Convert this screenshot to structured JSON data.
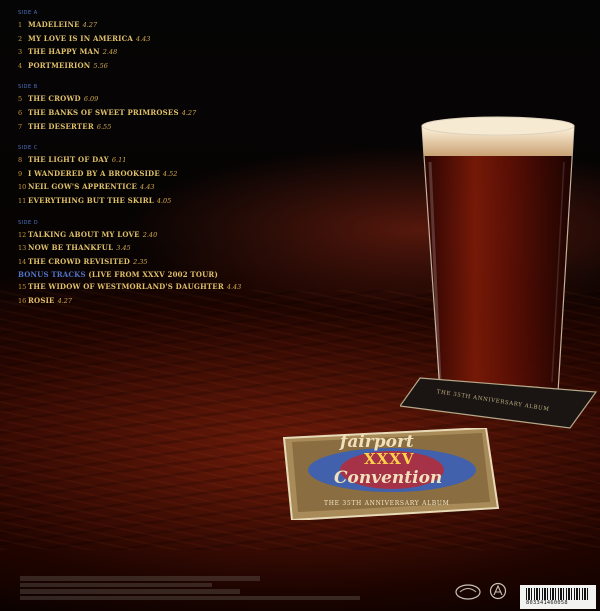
{
  "sides": [
    {
      "label": "SIDE A",
      "tracks": [
        {
          "n": "1",
          "title": "MADELEINE",
          "dur": "4.27"
        },
        {
          "n": "2",
          "title": "MY LOVE IS IN AMERICA",
          "dur": "4.43"
        },
        {
          "n": "3",
          "title": "THE HAPPY MAN",
          "dur": "2.48"
        },
        {
          "n": "4",
          "title": "PORTMEIRION",
          "dur": "5.56"
        }
      ]
    },
    {
      "label": "SIDE B",
      "tracks": [
        {
          "n": "5",
          "title": "THE CROWD",
          "dur": "6.09"
        },
        {
          "n": "6",
          "title": "THE BANKS OF SWEET PRIMROSES",
          "dur": "4.27"
        },
        {
          "n": "7",
          "title": "THE DESERTER",
          "dur": "6.55"
        }
      ]
    },
    {
      "label": "SIDE C",
      "tracks": [
        {
          "n": "8",
          "title": "THE LIGHT OF DAY",
          "dur": "6.11"
        },
        {
          "n": "9",
          "title": "I WANDERED BY A BROOKSIDE",
          "dur": "4.52"
        },
        {
          "n": "10",
          "title": "NEIL GOW'S APPRENTICE",
          "dur": "4.43"
        },
        {
          "n": "11",
          "title": "EVERYTHING BUT THE SKIRL",
          "dur": "4.05"
        }
      ]
    },
    {
      "label": "SIDE D",
      "tracks": [
        {
          "n": "12",
          "title": "TALKING ABOUT MY LOVE",
          "dur": "2.40"
        },
        {
          "n": "13",
          "title": "NOW BE THANKFUL",
          "dur": "3.45"
        },
        {
          "n": "14",
          "title": "THE CROWD REVISITED",
          "dur": "2.35"
        }
      ]
    }
  ],
  "bonus_label": "BONUS TRACKS",
  "bonus_note": "(LIVE FROM XXXV 2002 TOUR)",
  "bonus_tracks": [
    {
      "n": "15",
      "title": "THE WIDOW OF WESTMORLAND'S DAUGHTER",
      "dur": "4.43"
    },
    {
      "n": "16",
      "title": "ROSIE",
      "dur": "4.27"
    }
  ],
  "coaster": {
    "line1": "fairport",
    "line2": "XXXV",
    "line3": "Convention",
    "tagline": "THE 35TH ANNIVERSARY ALBUM",
    "small_tagline": "THE 35TH ANNIVERSARY ALBUM"
  },
  "barcode_number": "803341460058",
  "colors": {
    "title_gold": "#e0c06a",
    "side_blue": "#4f74c8",
    "beer": "#6a1206",
    "coaster_blue": "#3a5fb8"
  }
}
